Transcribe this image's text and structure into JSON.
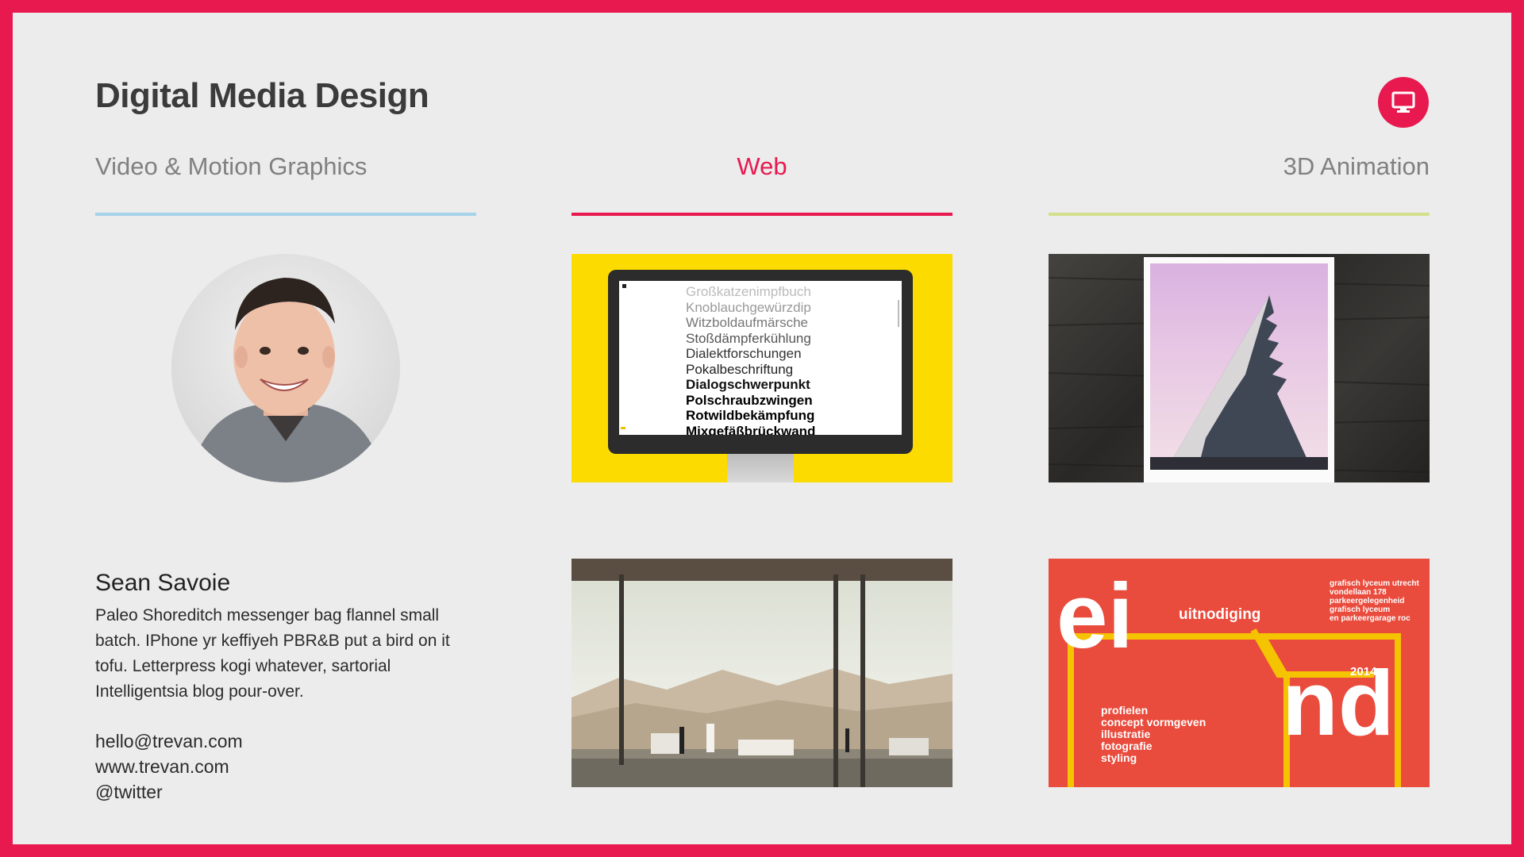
{
  "header": {
    "title": "Digital Media Design",
    "monitor_icon": "monitor-icon"
  },
  "tabs": [
    {
      "label": "Video & Motion Graphics",
      "color": "#a6d3ea",
      "active": false
    },
    {
      "label": "Web",
      "color": "#e8194f",
      "active": true
    },
    {
      "label": "3D Animation",
      "color": "#d4df8c",
      "active": false
    }
  ],
  "profile": {
    "name": "Sean Savoie",
    "bio": "Paleo Shoreditch messenger bag flannel small batch. IPhone yr keffiyeh PBR&B put a bird on it tofu. Letterpress kogi whatever, sartorial Intelligentsia blog pour-over.",
    "email": "hello@trevan.com",
    "website": "www.trevan.com",
    "twitter": "@twitter"
  },
  "thumbnails": {
    "web1": {
      "words": [
        "Großkatzenimpfbuch",
        "Knoblauchgewürzdip",
        "Witzboldaufmärsche",
        "Stoßdämpferkühlung",
        "Dialektforschungen",
        "Pokalbeschriftung",
        "Dialogschwerpunkt",
        "Polschraubzwingen",
        "Rotwildbekämpfung",
        "Mixgefäßbrückwand"
      ]
    },
    "anim2": {
      "big_ei": "ei",
      "big_nd": "nd",
      "invite": "uitnodiging",
      "year": "2014",
      "address": [
        "grafisch lyceum utrecht",
        "vondellaan 178",
        "parkeergelegenheid",
        "grafisch lyceum",
        "en parkeergarage roc"
      ],
      "items": [
        "profielen",
        "concept vormgeven",
        "illustratie",
        "fotografie",
        "styling"
      ]
    }
  },
  "colors": {
    "accent": "#e8194f",
    "background": "#ececec"
  }
}
